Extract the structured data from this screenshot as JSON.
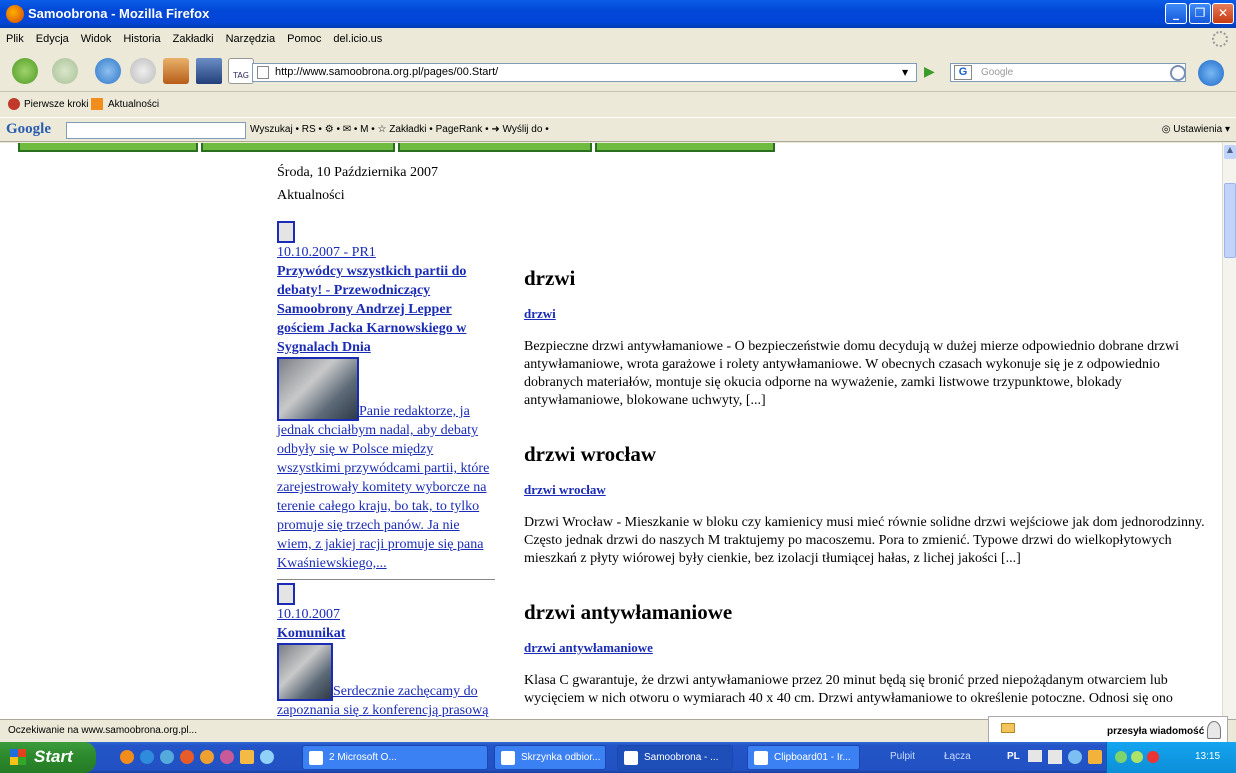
{
  "window": {
    "title": "Samoobrona - Mozilla Firefox"
  },
  "menu": [
    "Plik",
    "Edycja",
    "Widok",
    "Historia",
    "Zakładki",
    "Narzędzia",
    "Pomoc",
    "del.icio.us"
  ],
  "nav": {
    "url": "http://www.samoobrona.org.pl/pages/00.Start/",
    "search_placeholder": "Google",
    "tag_label": "TAG"
  },
  "bookmarks": [
    "Pierwsze kroki",
    "Aktualności"
  ],
  "google_toolbar": {
    "logo": "Google",
    "items": "Wyszukaj • RS • ⚙ • ✉ • M • ☆ Zakładki • PageRank • ➜ Wyślij do •",
    "settings": "Ustawienia"
  },
  "page": {
    "date": "Środa, 10 Października 2007",
    "section": "Aktualności",
    "news": [
      {
        "date": "10.10.2007 - PR1",
        "title": "Przywódcy wszystkich partii do debaty! - Przewodniczący Samoobrony Andrzej Lepper gościem Jacka Karnowskiego w Sygnalach Dnia",
        "excerpt": "Panie redaktorze, ja jednak chciałbym nadal, aby debaty odbyły się w Polsce między wszystkimi przywódcami partii, które zarejestrowały komitety wyborcze na terenie całego kraju, bo tak, to tylko promuje się trzech panów. Ja nie wiem, z jakiej racji promuje się pana Kwaśniewskiego,..."
      },
      {
        "date": "10.10.2007",
        "title": "Komunikat",
        "excerpt": "Serdecznie zachęcamy do zapoznania się z konferencją prasową"
      }
    ],
    "ads": [
      {
        "heading": "drzwi",
        "link": "drzwi",
        "text": "Bezpieczne drzwi antywłamaniowe - O bezpieczeństwie domu decydują w dużej mierze odpowiednio dobrane drzwi antywłamaniowe, wrota garażowe i rolety antywłamaniowe. W obecnych czasach wykonuje się je z odpowiednio dobranych materiałów, montuje się okucia odporne na wyważenie, zamki listwowe trzypunktowe, blokady antywłamaniowe, blokowane uchwyty, [...]"
      },
      {
        "heading": "drzwi wrocław",
        "link": "drzwi wrocław",
        "text": "Drzwi Wrocław - Mieszkanie w bloku czy kamienicy musi mieć równie solidne drzwi wejściowe jak dom jednorodzinny. Często jednak drzwi do naszych M traktujemy po macoszemu. Pora to zmienić. Typowe drzwi do wielkopłytowych mieszkań z płyty wiórowej były cienkie, bez izolacji tłumiącej hałas, z lichej jakości [...]"
      },
      {
        "heading": "drzwi antywłamaniowe",
        "link": "drzwi antywłamaniowe",
        "text": "Klasa C gwarantuje, że drzwi antywłamaniowe przez 20 minut będą się bronić przed niepożądanym otwarciem lub wycięciem w nich otworu o wymiarach 40 x 40 cm. Drzwi antywłamaniowe to określenie potoczne. Odnosi się ono"
      }
    ]
  },
  "status": {
    "text": "Oczekiwanie na www.samoobrona.org.pl...",
    "notify": "przesyła wiadomość"
  },
  "taskbar": {
    "start": "Start",
    "tasks": [
      "2 Microsoft O...",
      "Skrzynka odbior...",
      "Samoobrona - ...",
      "Clipboard01 - Ir..."
    ],
    "toolbars": [
      "Pulpit",
      "Łącza"
    ],
    "lang": "PL",
    "clock": "13:15"
  }
}
